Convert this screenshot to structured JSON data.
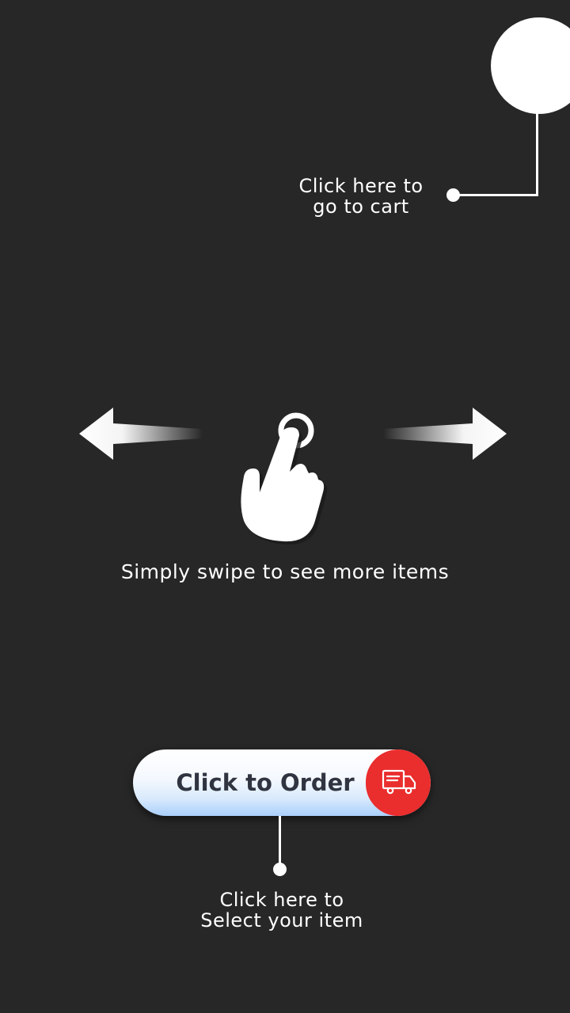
{
  "cart_hint": {
    "line1": "Click here to",
    "line2": "go to cart"
  },
  "swipe_hint": {
    "text": "Simply swipe to see more items",
    "icons": [
      "arrow-left-icon",
      "tap-hand-icon",
      "arrow-right-icon"
    ]
  },
  "order_button": {
    "label": "Click to Order",
    "icon": "delivery-truck-icon"
  },
  "select_hint": {
    "line1": "Click here to",
    "line2": "Select your item"
  },
  "colors": {
    "background": "#272727",
    "accent_red": "#ea2d2d",
    "text": "#ffffff",
    "button_text": "#2f3440"
  }
}
